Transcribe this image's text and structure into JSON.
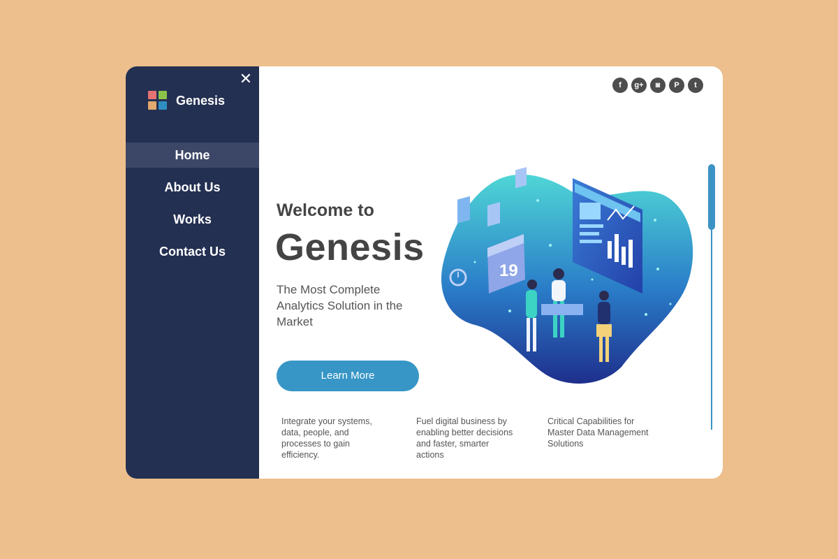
{
  "sidebar": {
    "brand": "Genesis",
    "close_symbol": "✕",
    "logo_colors": [
      "#E57373",
      "#8BC34A",
      "#E0A96D",
      "#2F8FC1"
    ],
    "nav": [
      {
        "label": "Home",
        "active": true
      },
      {
        "label": "About Us",
        "active": false
      },
      {
        "label": "Works",
        "active": false
      },
      {
        "label": "Contact Us",
        "active": false
      }
    ]
  },
  "social": [
    {
      "name": "facebook-icon",
      "glyph": "f"
    },
    {
      "name": "google-plus-icon",
      "glyph": "g+"
    },
    {
      "name": "instagram-icon",
      "glyph": "◙"
    },
    {
      "name": "pinterest-icon",
      "glyph": "P"
    },
    {
      "name": "twitter-icon",
      "glyph": "t"
    }
  ],
  "hero": {
    "welcome": "Welcome to",
    "title": "Genesis",
    "subtitle": "The Most Complete Analytics Solution in the Market",
    "cta_label": "Learn More",
    "calendar_day": "19"
  },
  "features": [
    "Integrate your systems, data, people, and processes to gain efficiency.",
    "Fuel digital business by enabling better decisions and faster, smarter actions",
    "Critical Capabilities for Master Data Management Solutions"
  ],
  "colors": {
    "page_bg": "#EDBF8C",
    "sidebar_bg": "#243052",
    "accent": "#3796C6"
  }
}
